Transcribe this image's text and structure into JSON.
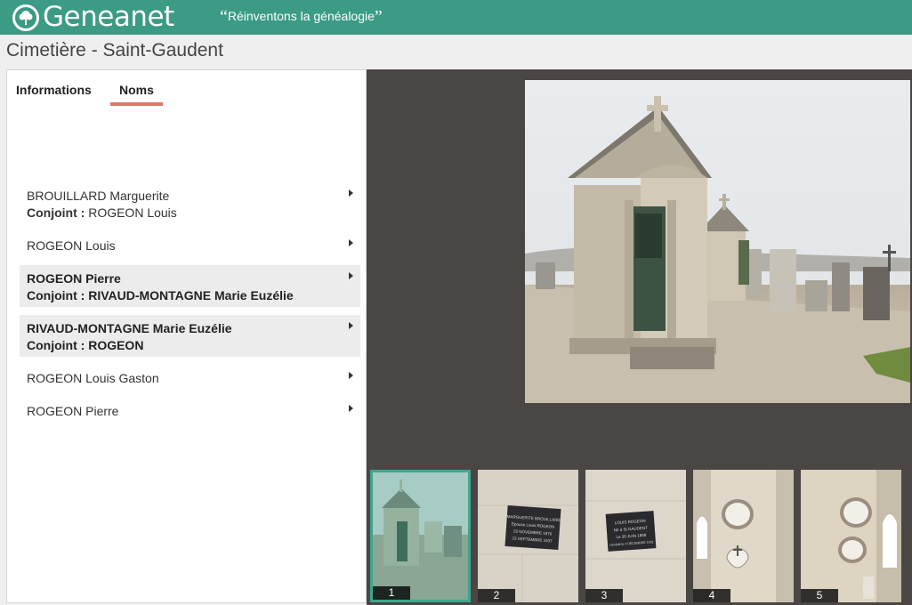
{
  "header": {
    "logo_text": "Geneanet",
    "tagline_open": "“",
    "tagline": "Réinventons la généalogie",
    "tagline_close": "”"
  },
  "page": {
    "title": "Cimetière - Saint-Gaudent"
  },
  "tabs": [
    {
      "label": "Informations",
      "active": false
    },
    {
      "label": "Noms",
      "active": true
    }
  ],
  "names": [
    {
      "name": "BROUILLARD Marguerite",
      "spouse_label": "Conjoint :",
      "spouse": "ROGEON Louis",
      "selected": false
    },
    {
      "name": "ROGEON Louis",
      "selected": false
    },
    {
      "name": "ROGEON Pierre",
      "spouse_label": "Conjoint :",
      "spouse": "RIVAUD-MONTAGNE Marie Euzélie",
      "selected": true
    },
    {
      "name": "RIVAUD-MONTAGNE Marie Euzélie",
      "spouse_label": "Conjoint :",
      "spouse": "ROGEON",
      "selected": true
    },
    {
      "name": "ROGEON Louis Gaston",
      "selected": false
    },
    {
      "name": "ROGEON Pierre",
      "selected": false
    }
  ],
  "thumbnails": [
    {
      "num": "1",
      "active": true
    },
    {
      "num": "2",
      "active": false
    },
    {
      "num": "3",
      "active": false
    },
    {
      "num": "4",
      "active": false
    },
    {
      "num": "5",
      "active": false
    }
  ],
  "plaques": {
    "p2": [
      "MARGUERITE BROUILLARD",
      "Épouse Louis ROGEON",
      "25 NOVEMBRE 1876",
      "23 SEPTEMBRE 1937"
    ],
    "p3": [
      "LOUIS ROGEON",
      "Né à St GAUDENT",
      "Le 30 JUIN 1868",
      "Décédé le 4 DÉCEMBRE 1931"
    ]
  },
  "colors": {
    "brand": "#3b9b84",
    "tab_accent": "#e0776b",
    "viewer_bg": "#4a4644",
    "active_thumb": "#3fa590"
  }
}
